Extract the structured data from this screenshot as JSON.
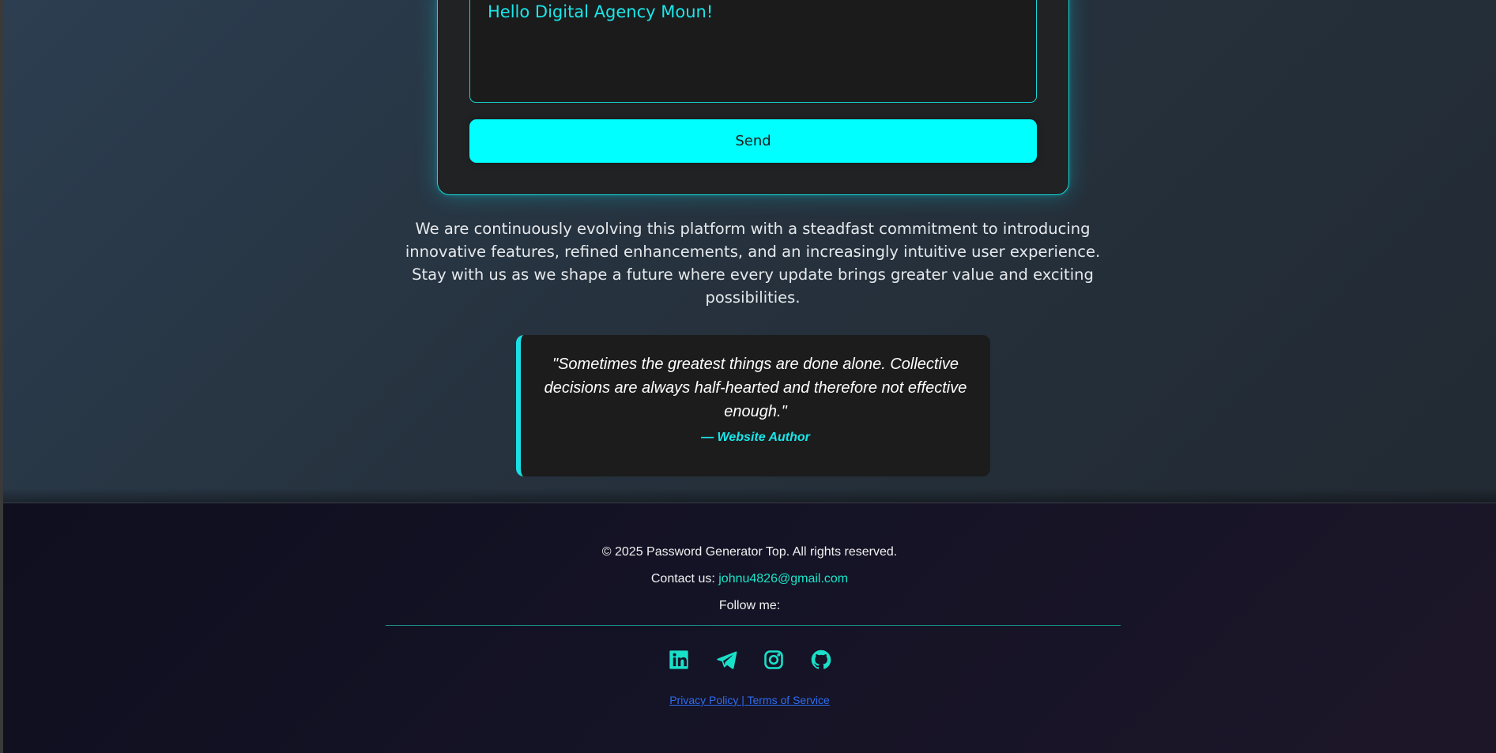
{
  "form": {
    "message_value": "Hello Digital Agency Moun!",
    "send_label": "Send"
  },
  "intro": {
    "text": "We are continuously evolving this platform with a steadfast commitment to introducing innovative features, refined enhancements, and an increasingly intuitive user experience. Stay with us as we shape a future where every update brings greater value and exciting possibilities."
  },
  "quote": {
    "text": "\"Sometimes the greatest things are done alone. Collective decisions are always half-hearted and therefore not effective enough.\"",
    "author": "— Website Author"
  },
  "footer": {
    "copyright": "© 2025 Password Generator Top. All rights reserved.",
    "contact_label": "Contact us: ",
    "contact_email": "johnu4826@gmail.com",
    "follow_label": "Follow me:",
    "social": [
      {
        "name": "linkedin-icon"
      },
      {
        "name": "telegram-icon"
      },
      {
        "name": "instagram-icon"
      },
      {
        "name": "github-icon"
      }
    ],
    "legal_link": "Privacy Policy | Terms of Service"
  },
  "colors": {
    "accent": "#00ffff",
    "accent_text": "#19e6ea",
    "link": "#2d6df0",
    "footer_bg": "#151326"
  }
}
